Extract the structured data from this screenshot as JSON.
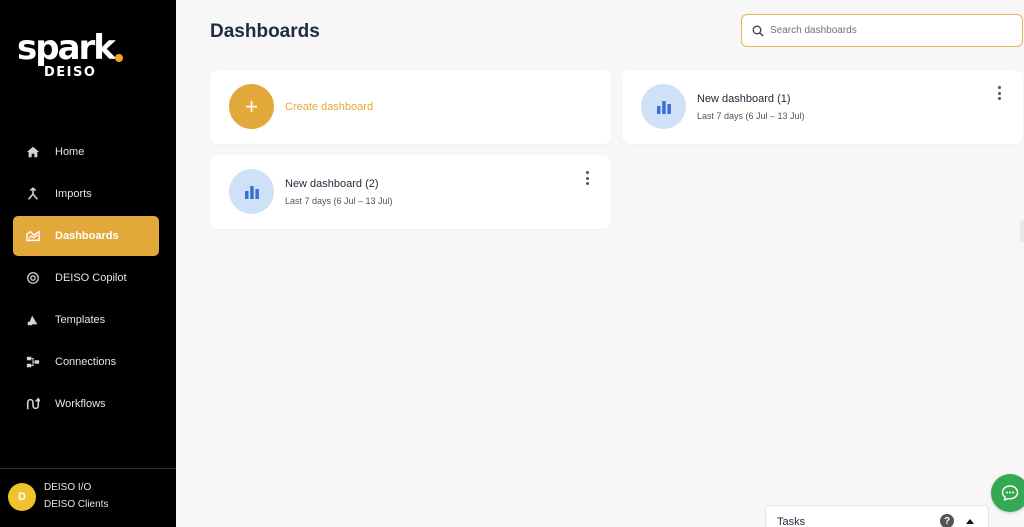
{
  "brand": {
    "logo_main": "spark",
    "logo_sub": "DEISO"
  },
  "sidebar": {
    "items": [
      {
        "label": "Home",
        "icon": "home-icon"
      },
      {
        "label": "Imports",
        "icon": "imports-icon"
      },
      {
        "label": "Dashboards",
        "icon": "dashboards-icon",
        "active": true
      },
      {
        "label": "DEISO Copilot",
        "icon": "copilot-icon"
      },
      {
        "label": "Templates",
        "icon": "templates-icon"
      },
      {
        "label": "Connections",
        "icon": "connections-icon"
      },
      {
        "label": "Workflows",
        "icon": "workflows-icon"
      }
    ],
    "user": {
      "initial": "D",
      "name": "DEISO I/O",
      "org": "DEISO Clients"
    }
  },
  "header": {
    "title": "Dashboards"
  },
  "search": {
    "placeholder": "Search dashboards",
    "value": ""
  },
  "cards": {
    "create": {
      "label": "Create dashboard",
      "icon": "plus-icon"
    },
    "dashboards": [
      {
        "title": "New dashboard (1)",
        "range": "Last 7 days (6 Jul – 13 Jul)",
        "icon": "bar-chart-icon"
      },
      {
        "title": "New dashboard (2)",
        "range": "Last 7 days (6 Jul – 13 Jul)",
        "icon": "bar-chart-icon"
      }
    ]
  },
  "tasks": {
    "label": "Tasks",
    "help": "?"
  },
  "colors": {
    "accent": "#e3a83a",
    "sidebar_bg": "#000000",
    "chart_circle": "#cfe1f7",
    "chart_bars": "#3b6fd6",
    "chat_fab": "#34a853"
  }
}
